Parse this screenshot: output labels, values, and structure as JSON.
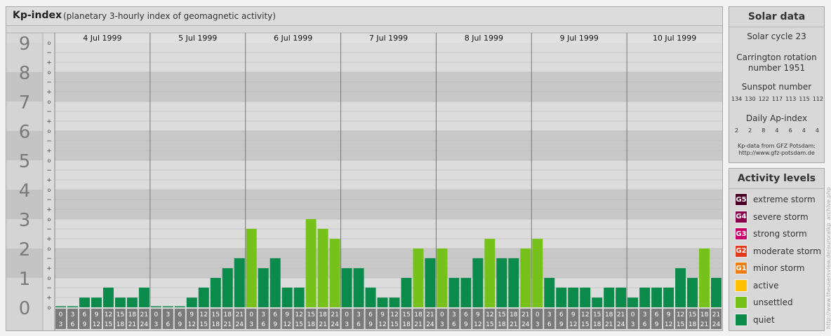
{
  "title": "Kp-index",
  "subtitle": "(planetary 3-hourly index of geomagnetic activity)",
  "chart_data": {
    "type": "bar",
    "title": "Kp-index",
    "subtitle": "(planetary 3-hourly index of geomagnetic activity)",
    "ylim": [
      0,
      9
    ],
    "y_major_ticks": [
      "0",
      "1",
      "2",
      "3",
      "4",
      "5",
      "6",
      "7",
      "8",
      "9"
    ],
    "y_minor_tick_labels": [
      "+",
      "o",
      "−"
    ],
    "days": [
      "4 Jul 1999",
      "5 Jul 1999",
      "6 Jul 1999",
      "7 Jul 1999",
      "8 Jul 1999",
      "9 Jul 1999",
      "10 Jul 1999"
    ],
    "interval_start_labels": [
      "0",
      "3",
      "6",
      "9",
      "12",
      "15",
      "18",
      "21"
    ],
    "interval_end_labels": [
      "3",
      "6",
      "9",
      "12",
      "15",
      "18",
      "21",
      "24"
    ],
    "values": [
      [
        0.0,
        0.0,
        0.33,
        0.33,
        0.67,
        0.33,
        0.33,
        0.67
      ],
      [
        0.0,
        0.0,
        0.0,
        0.33,
        0.67,
        1.0,
        1.33,
        1.67
      ],
      [
        2.67,
        1.33,
        1.67,
        0.67,
        0.67,
        3.0,
        2.67,
        2.33
      ],
      [
        1.33,
        1.33,
        0.67,
        0.33,
        0.33,
        1.0,
        2.0,
        1.67
      ],
      [
        2.0,
        1.0,
        1.0,
        1.67,
        2.33,
        1.67,
        1.67,
        2.0
      ],
      [
        2.33,
        1.0,
        0.67,
        0.67,
        0.67,
        0.33,
        0.67,
        0.67
      ],
      [
        0.33,
        0.67,
        0.67,
        0.67,
        1.33,
        1.0,
        2.0,
        1.0
      ]
    ],
    "grid": true
  },
  "solar": {
    "heading": "Solar data",
    "cycle": "Solar cycle 23",
    "carrington_line1": "Carrington rotation",
    "carrington_line2": "number 1951",
    "sunspot_label": "Sunspot number",
    "sunspot_values": [
      "134",
      "130",
      "122",
      "117",
      "113",
      "115",
      "112"
    ],
    "ap_label": "Daily Ap-index",
    "ap_values": [
      "2",
      "2",
      "8",
      "4",
      "6",
      "4",
      "4"
    ],
    "source_line1": "Kp-data from GFZ Potsdam:",
    "source_line2": "http://www.gfz-potsdam.de"
  },
  "activity": {
    "heading": "Activity levels",
    "levels": [
      {
        "code": "G5",
        "label": "extreme storm",
        "color": "#4d0026"
      },
      {
        "code": "G4",
        "label": "severe storm",
        "color": "#8b004b"
      },
      {
        "code": "G3",
        "label": "strong storm",
        "color": "#c60068"
      },
      {
        "code": "G2",
        "label": "moderate storm",
        "color": "#e33a1e"
      },
      {
        "code": "G1",
        "label": "minor storm",
        "color": "#ef7d14"
      },
      {
        "code": "",
        "label": "active",
        "color": "#ffc000"
      },
      {
        "code": "",
        "label": "unsettled",
        "color": "#76c21b"
      },
      {
        "code": "",
        "label": "quiet",
        "color": "#0a8b4b"
      }
    ]
  },
  "credit": "http://www.theusersview.de/auroralkp_archive.php"
}
